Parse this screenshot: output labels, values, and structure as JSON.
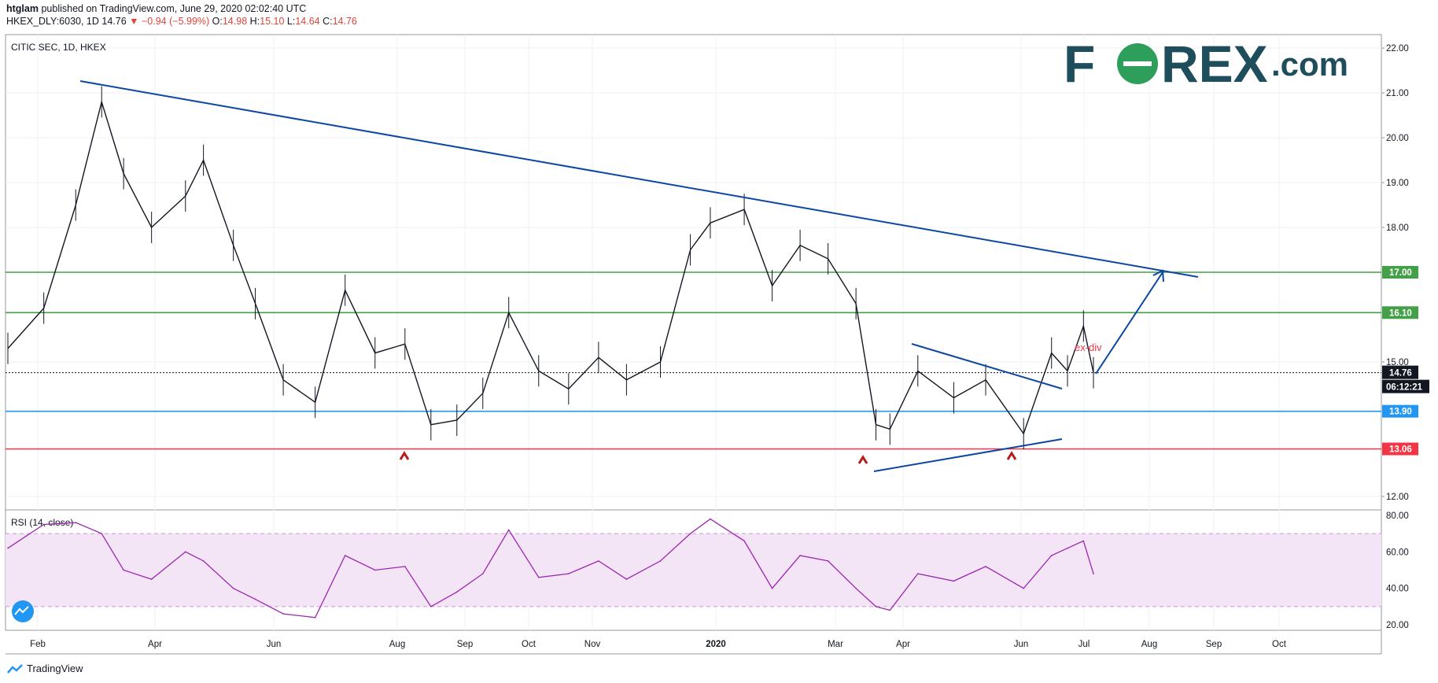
{
  "header": {
    "author": "htglam",
    "published_text": "published on TradingView.com, June 29, 2020 02:02:40 UTC",
    "symbol": "HKEX_DLY:6030, 1D",
    "last": "14.76",
    "change": "▼ −0.94 (−5.99%)",
    "o_label": "O:",
    "o_value": "14.98",
    "h_label": "H:",
    "h_value": "15.10",
    "l_label": "L:",
    "l_value": "14.64",
    "c_label": "C:",
    "c_value": "14.76"
  },
  "pane_title": "CITIC SEC, 1D, HKEX",
  "rsi_title": "RSI (14, close)",
  "logo_text": "FΘREX.com",
  "footer": {
    "brand": "TradingView"
  },
  "colors": {
    "price": "#131722",
    "green": "#43a047",
    "blue_level": "#2196f3",
    "red_level": "#f23645",
    "trend": "#0d47a1",
    "rsi": "#9c27b0",
    "rsi_band": "#f3e5f5",
    "logo_dark": "#1e4d5c",
    "logo_green": "#2e9e5b"
  },
  "chart_data": [
    {
      "type": "line",
      "title": "CITIC SEC, 1D, HKEX",
      "ylim": [
        11.7,
        22.3
      ],
      "y_ticks": [
        "22.00",
        "21.00",
        "20.00",
        "19.00",
        "18.00",
        "15.00",
        "12.00"
      ],
      "x_ticks": [
        "Feb",
        "Apr",
        "Jun",
        "Aug",
        "Sep",
        "Oct",
        "Nov",
        "2020",
        "Mar",
        "Apr",
        "Jun",
        "Jul",
        "Aug",
        "Sep",
        "Oct"
      ],
      "series": [
        {
          "x": [
            "2019-01-02",
            "2019-01-20",
            "2019-02-05",
            "2019-02-18",
            "2019-03-01",
            "2019-03-15",
            "2019-04-01",
            "2019-04-10",
            "2019-04-25",
            "2019-05-06",
            "2019-05-20",
            "2019-06-05",
            "2019-06-20",
            "2019-07-05",
            "2019-07-20",
            "2019-08-02",
            "2019-08-15",
            "2019-08-28",
            "2019-09-10",
            "2019-09-25",
            "2019-10-10",
            "2019-10-25",
            "2019-11-08",
            "2019-11-25",
            "2019-12-10",
            "2019-12-20",
            "2020-01-06",
            "2020-01-20",
            "2020-02-03",
            "2020-02-17",
            "2020-03-02",
            "2020-03-12",
            "2020-03-19",
            "2020-04-02",
            "2020-04-20",
            "2020-05-06",
            "2020-05-25",
            "2020-06-08",
            "2020-06-16",
            "2020-06-24",
            "2020-06-29"
          ],
          "values": [
            15.3,
            16.2,
            18.5,
            20.8,
            19.2,
            18.0,
            18.7,
            19.5,
            17.6,
            16.3,
            14.6,
            14.1,
            16.6,
            15.2,
            15.4,
            13.6,
            13.7,
            14.3,
            16.1,
            14.8,
            14.4,
            15.1,
            14.6,
            15.0,
            17.5,
            18.1,
            18.4,
            16.7,
            17.6,
            17.3,
            16.3,
            13.6,
            13.5,
            14.8,
            14.2,
            14.6,
            13.4,
            15.2,
            14.8,
            15.8,
            14.76
          ]
        }
      ],
      "horizontal_levels": [
        "17.00",
        "16.10",
        "13.90",
        "13.06"
      ],
      "current_price_label": "14.76",
      "countdown_label": "06:12:21",
      "annotations": [
        "ex-div"
      ]
    },
    {
      "type": "line",
      "title": "RSI (14, close)",
      "ylim": [
        17,
        83
      ],
      "y_ticks": [
        "80.00",
        "60.00",
        "40.00",
        "20.00"
      ],
      "band": [
        30,
        70
      ],
      "series": [
        {
          "x": [
            "2019-01-02",
            "2019-01-20",
            "2019-02-05",
            "2019-02-18",
            "2019-03-01",
            "2019-03-15",
            "2019-04-01",
            "2019-04-10",
            "2019-04-25",
            "2019-05-06",
            "2019-05-20",
            "2019-06-05",
            "2019-06-20",
            "2019-07-05",
            "2019-07-20",
            "2019-08-02",
            "2019-08-15",
            "2019-08-28",
            "2019-09-10",
            "2019-09-25",
            "2019-10-10",
            "2019-10-25",
            "2019-11-08",
            "2019-11-25",
            "2019-12-10",
            "2019-12-20",
            "2020-01-06",
            "2020-01-20",
            "2020-02-03",
            "2020-02-17",
            "2020-03-02",
            "2020-03-12",
            "2020-03-19",
            "2020-04-02",
            "2020-04-20",
            "2020-05-06",
            "2020-05-25",
            "2020-06-08",
            "2020-06-16",
            "2020-06-24",
            "2020-06-29"
          ],
          "values": [
            62,
            75,
            76,
            70,
            50,
            45,
            60,
            55,
            40,
            34,
            26,
            24,
            58,
            50,
            52,
            30,
            38,
            48,
            72,
            46,
            48,
            55,
            45,
            55,
            70,
            78,
            66,
            40,
            58,
            55,
            40,
            30,
            28,
            48,
            44,
            52,
            40,
            58,
            62,
            66,
            48
          ]
        }
      ]
    }
  ]
}
